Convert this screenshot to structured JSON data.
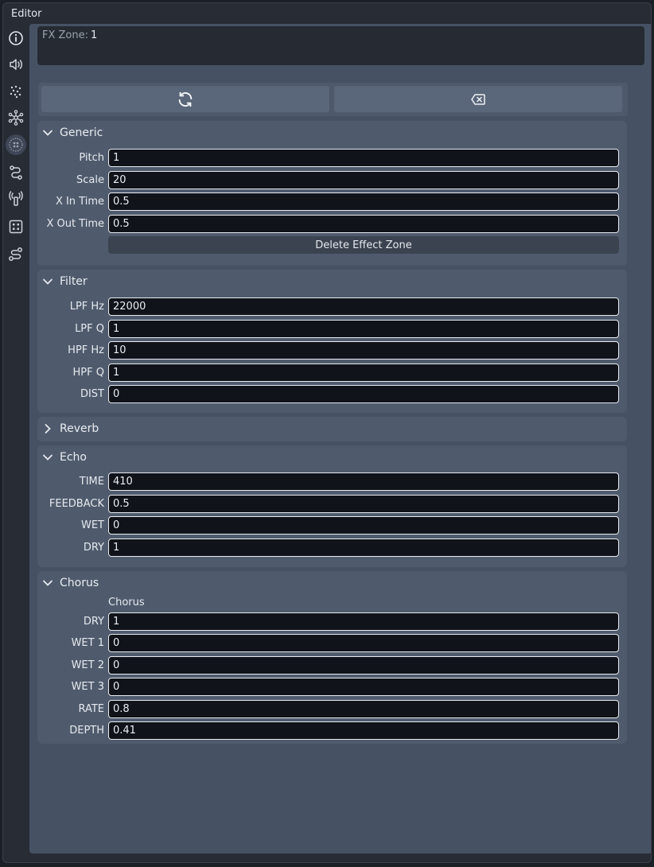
{
  "window": {
    "title": "Editor"
  },
  "sidebar": {
    "items": [
      {
        "icon": "info-icon",
        "active": false
      },
      {
        "icon": "speaker-icon",
        "active": false
      },
      {
        "icon": "dots-grid-icon",
        "active": false
      },
      {
        "icon": "network-icon",
        "active": false
      },
      {
        "icon": "effect-zone-icon",
        "active": true
      },
      {
        "icon": "path-icon",
        "active": false
      },
      {
        "icon": "antenna-icon",
        "active": false
      },
      {
        "icon": "dice-icon",
        "active": false
      },
      {
        "icon": "route-icon",
        "active": false
      }
    ]
  },
  "fx_zone": {
    "label": "FX Zone:",
    "value": "1"
  },
  "toolbar": {
    "refresh_icon": "refresh-icon",
    "clear_icon": "backspace-icon"
  },
  "sections": {
    "generic": {
      "title": "Generic",
      "rows": [
        {
          "label": "Pitch",
          "value": "1"
        },
        {
          "label": "Scale",
          "value": "20"
        },
        {
          "label": "X In Time",
          "value": "0.5"
        },
        {
          "label": "X Out Time",
          "value": "0.5"
        }
      ],
      "delete_label": "Delete Effect Zone"
    },
    "filter": {
      "title": "Filter",
      "rows": [
        {
          "label": "LPF Hz",
          "value": "22000"
        },
        {
          "label": "LPF Q",
          "value": "1"
        },
        {
          "label": "HPF Hz",
          "value": "10"
        },
        {
          "label": "HPF Q",
          "value": "1"
        },
        {
          "label": "DIST",
          "value": "0"
        }
      ]
    },
    "reverb": {
      "title": "Reverb"
    },
    "echo": {
      "title": "Echo",
      "rows": [
        {
          "label": "TIME",
          "value": "410"
        },
        {
          "label": "FEEDBACK",
          "value": "0.5"
        },
        {
          "label": "WET",
          "value": "0"
        },
        {
          "label": "DRY",
          "value": "1"
        }
      ]
    },
    "chorus": {
      "title": "Chorus",
      "subtitle": "Chorus",
      "rows": [
        {
          "label": "DRY",
          "value": "1"
        },
        {
          "label": "WET 1",
          "value": "0"
        },
        {
          "label": "WET 2",
          "value": "0"
        },
        {
          "label": "WET 3",
          "value": "0"
        },
        {
          "label": "RATE",
          "value": "0.8"
        },
        {
          "label": "DEPTH",
          "value": "0.41"
        }
      ]
    }
  }
}
